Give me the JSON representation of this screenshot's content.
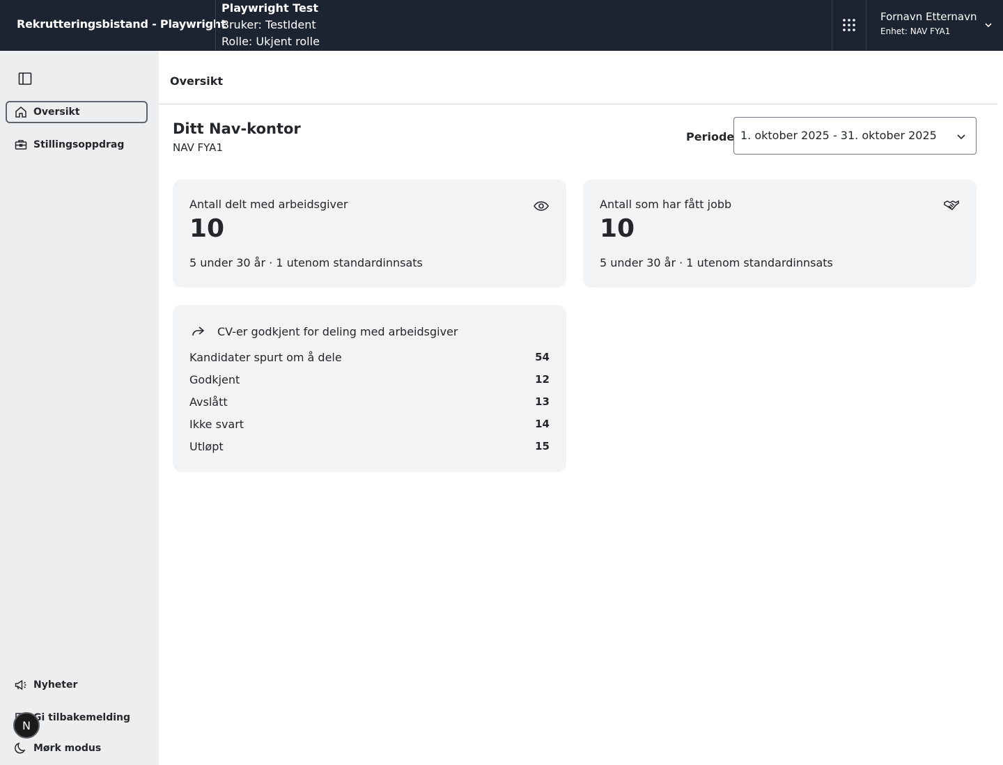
{
  "header": {
    "app_title": "Rekrutteringsbistand - Playwright",
    "env": {
      "name": "Playwright Test",
      "user": "Bruker: TestIdent",
      "role": "Rolle: Ukjent rolle"
    },
    "user_menu": {
      "name": "Fornavn Etternavn",
      "unit": "Enhet: NAV FYA1"
    }
  },
  "sidebar": {
    "items": [
      {
        "label": "Oversikt",
        "icon": "home-icon",
        "active": true
      },
      {
        "label": "Stillingsoppdrag",
        "icon": "briefcase-icon",
        "active": false
      }
    ],
    "bottom_items": [
      {
        "label": "Nyheter",
        "icon": "megaphone-icon"
      },
      {
        "label": "Gi tilbakemelding",
        "icon": "chat-icon"
      },
      {
        "label": "Mørk modus",
        "icon": "moon-icon"
      }
    ],
    "avatar_letter": "N"
  },
  "main": {
    "tab_title": "Oversikt",
    "office_title": "Ditt Nav-kontor",
    "office_unit": "NAV FYA1",
    "periode_label": "Periode",
    "periode_value": "1. oktober 2025 - 31. oktober 2025",
    "cards": [
      {
        "label": "Antall delt med arbeidsgiver",
        "value": "10",
        "sub": "5 under 30 år · 1 utenom standardinnsats",
        "icon": "eye-icon"
      },
      {
        "label": "Antall som har fått jobb",
        "value": "10",
        "sub": "5 under 30 år · 1 utenom standardinnsats",
        "icon": "handshake-icon"
      }
    ],
    "cv_card": {
      "title": "CV-er godkjent for deling med arbeidsgiver",
      "icon": "share-arrow-icon",
      "rows": [
        {
          "label": "Kandidater spurt om å dele",
          "value": "54"
        },
        {
          "label": "Godkjent",
          "value": "12"
        },
        {
          "label": "Avslått",
          "value": "13"
        },
        {
          "label": "Ikke svart",
          "value": "14"
        },
        {
          "label": "Utløpt",
          "value": "15"
        }
      ]
    }
  },
  "colors": {
    "header_bg": "#1c2431",
    "sidebar_bg": "#eceef0",
    "card_bg": "#f2f3f5",
    "text": "#23262a"
  }
}
